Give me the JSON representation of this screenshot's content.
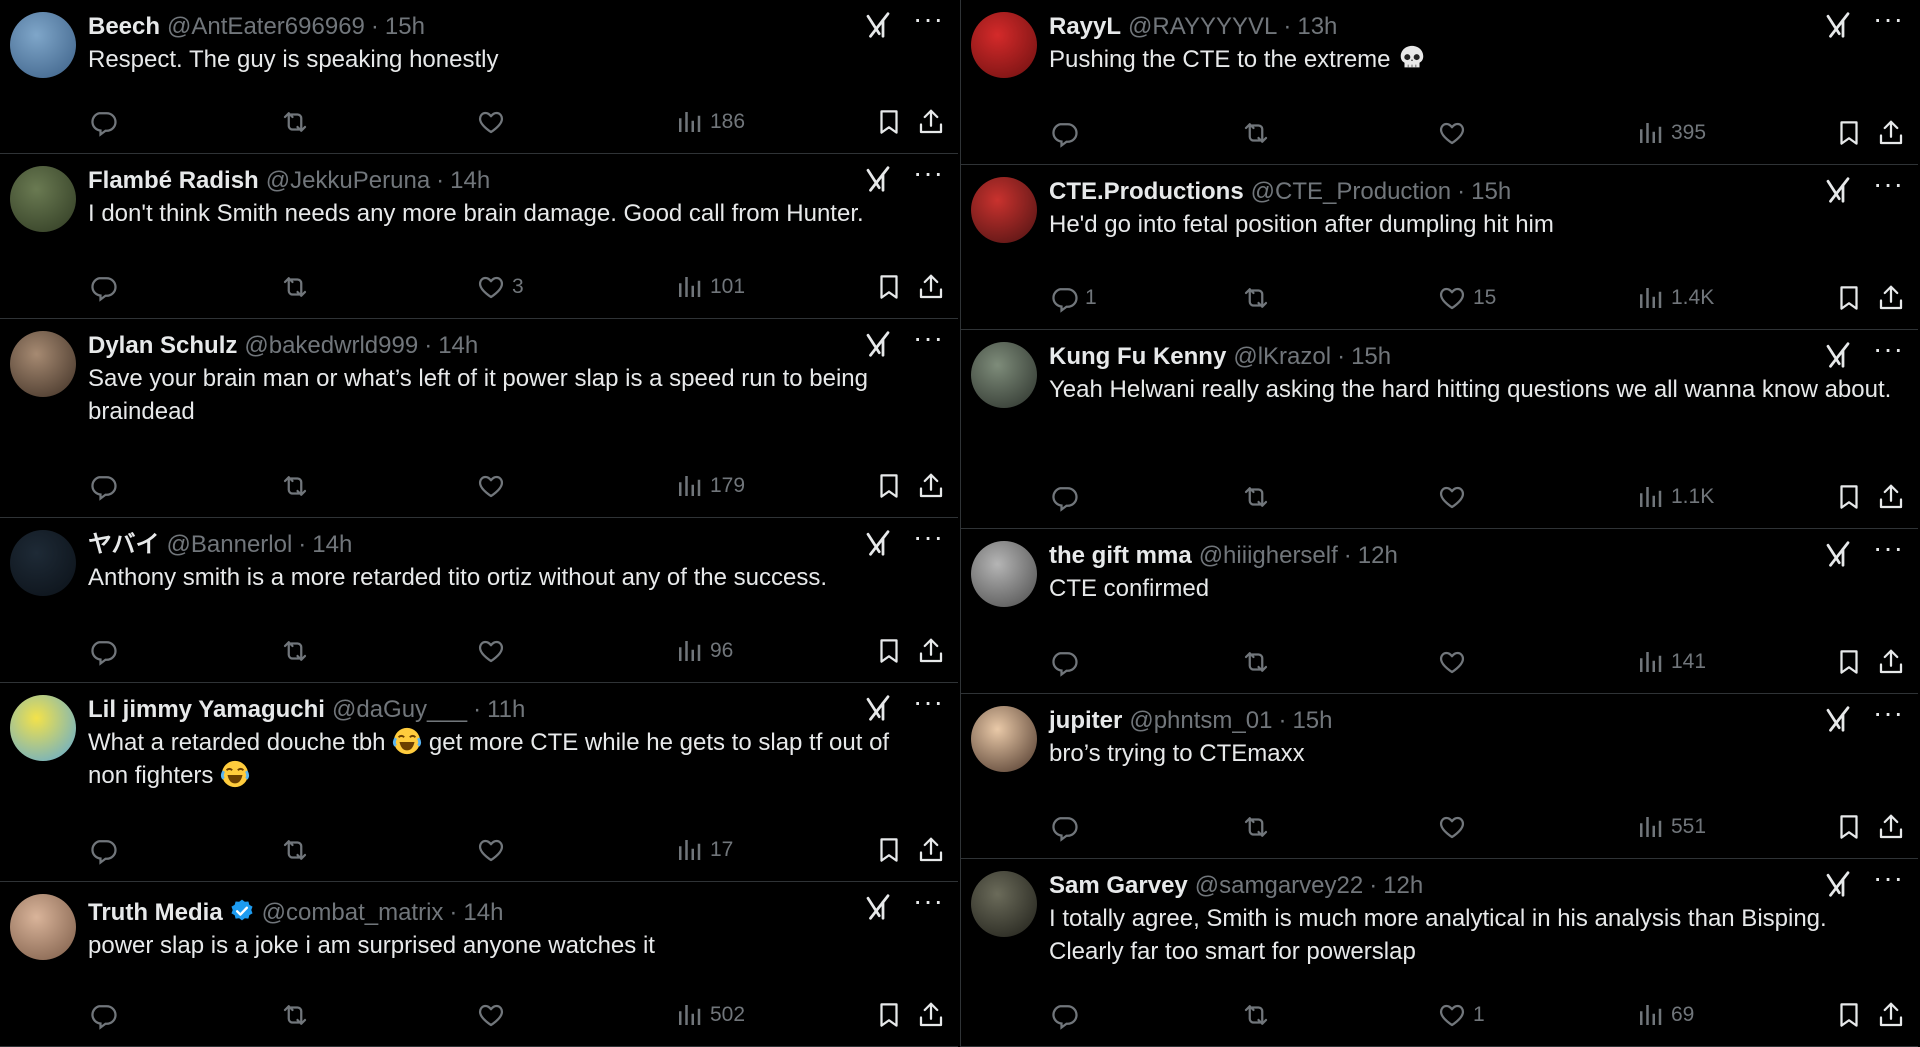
{
  "columns": [
    {
      "tweets": [
        {
          "name": "Beech",
          "handle": "@AntEater696969",
          "time": "15h",
          "text": "Respect.  The guy is speaking honestly",
          "replies": "",
          "likes": "",
          "views": "186",
          "avatar_colors": [
            "#7fa6c9",
            "#3b5f86"
          ]
        },
        {
          "name": "Flambé Radish",
          "handle": "@JekkuPeruna",
          "time": "14h",
          "text": "I don't think Smith needs any more brain damage. Good call from Hunter.",
          "replies": "",
          "likes": "3",
          "views": "101",
          "avatar_colors": [
            "#6a7a52",
            "#2f3a22"
          ]
        },
        {
          "name": "Dylan Schulz",
          "handle": "@bakedwrld999",
          "time": "14h",
          "text": "Save your brain man or what’s left of it power slap is a speed run to being braindead",
          "replies": "",
          "likes": "",
          "views": "179",
          "avatar_colors": [
            "#a68a72",
            "#3e2f24"
          ]
        },
        {
          "name": "ヤバイ",
          "handle": "@Bannerlol",
          "time": "14h",
          "text": "Anthony smith is a more retarded tito ortiz without any of the success.",
          "replies": "",
          "likes": "",
          "views": "96",
          "avatar_colors": [
            "#1e2a36",
            "#0b1118"
          ]
        },
        {
          "name": "Lil jimmy Yamaguchi",
          "handle": "@daGuy___",
          "time": "11h",
          "text_parts": [
            "What a retarded douche tbh ",
            " get more CTE while he gets to slap tf out of non fighters "
          ],
          "replies": "",
          "likes": "",
          "views": "17",
          "avatar_colors": [
            "#f3e24a",
            "#5aa7d8"
          ]
        },
        {
          "name": "Truth Media",
          "handle": "@combat_matrix",
          "time": "14h",
          "verified": true,
          "text": "power slap is a joke i am surprised anyone watches it",
          "replies": "",
          "likes": "",
          "views": "502",
          "avatar_colors": [
            "#d9b49a",
            "#7a5a46"
          ]
        }
      ]
    },
    {
      "tweets": [
        {
          "name": "RayyL",
          "handle": "@RAYYYYVL",
          "time": "13h",
          "text_parts": [
            "Pushing the CTE to the extreme "
          ],
          "skull": true,
          "replies": "",
          "likes": "",
          "views": "395",
          "avatar_colors": [
            "#d42a2a",
            "#6b1010"
          ]
        },
        {
          "name": "CTE.Productions",
          "handle": "@CTE_Production",
          "time": "15h",
          "text": "He'd go into fetal position after dumpling hit him",
          "replies": "1",
          "likes": "15",
          "views": "1.4K",
          "avatar_colors": [
            "#c9322e",
            "#4a1212"
          ]
        },
        {
          "name": "Kung Fu Kenny",
          "handle": "@lKrazol",
          "time": "15h",
          "text": "Yeah Helwani really asking the hard hitting questions we all wanna know about.",
          "replies": "",
          "likes": "",
          "views": "1.1K",
          "avatar_colors": [
            "#7e8c7a",
            "#2a302a"
          ]
        },
        {
          "name": "the gift mma",
          "handle": "@hiiigherself",
          "time": "12h",
          "text": "CTE confirmed",
          "replies": "",
          "likes": "",
          "views": "141",
          "avatar_colors": [
            "#b5b5b5",
            "#4a4a4a"
          ]
        },
        {
          "name": "jupiter",
          "handle": "@phntsm_01",
          "time": "15h",
          "text": "bro’s trying to CTEmaxx",
          "replies": "",
          "likes": "",
          "views": "551",
          "avatar_colors": [
            "#e9c9a8",
            "#4a3428"
          ]
        },
        {
          "name": "Sam Garvey",
          "handle": "@samgarvey22",
          "time": "12h",
          "text": "I totally agree, Smith is much more analytical in his analysis than Bisping. Clearly far too smart for powerslap",
          "replies": "",
          "likes": "1",
          "views": "69",
          "avatar_colors": [
            "#6b6b5a",
            "#1e1e18"
          ]
        }
      ]
    }
  ]
}
